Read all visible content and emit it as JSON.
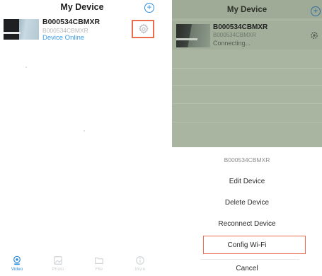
{
  "left": {
    "title": "My Device",
    "device": {
      "name": "B000534CBMXR",
      "id": "B000534CBMXR",
      "status": "Device Online"
    },
    "tabs": [
      {
        "label": "Video"
      },
      {
        "label": "Photo"
      },
      {
        "label": "File"
      },
      {
        "label": "More"
      }
    ]
  },
  "right": {
    "title": "My Device",
    "device": {
      "name": "B000534CBMXR",
      "id": "B000534CBMXR",
      "status": "Connecting..."
    },
    "sheet": {
      "title": "B000534CBMXR",
      "items": [
        "Edit Device",
        "Delete Device",
        "Reconnect Device",
        "Config Wi-Fi"
      ],
      "cancel": "Cancel"
    }
  },
  "colors": {
    "accent": "#2f8fe0",
    "highlight_box": "#ea6d4d",
    "overlay": "#a9b5a0"
  },
  "icons": {
    "add": "plus-circle-icon",
    "settings": "gear-icon",
    "video": "webcam-icon",
    "photo": "photo-icon",
    "file": "folder-icon",
    "more": "info-icon"
  }
}
